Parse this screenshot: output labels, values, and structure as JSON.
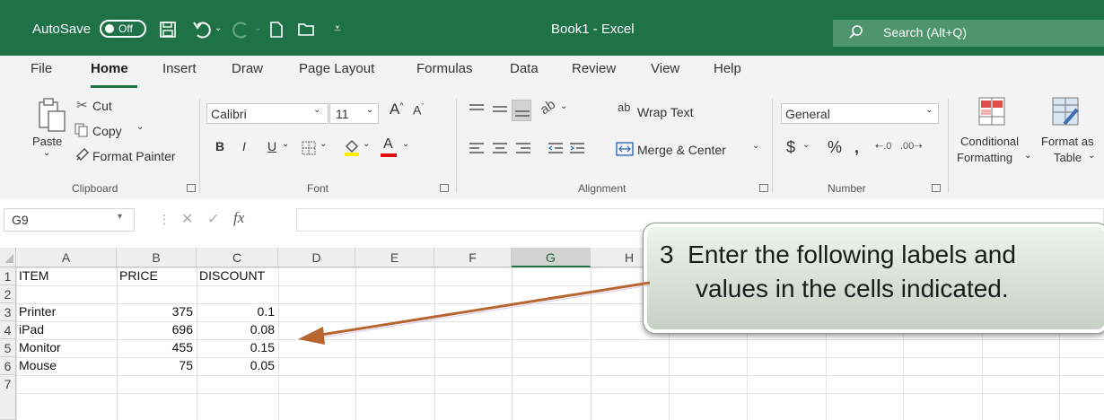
{
  "titlebar": {
    "autosave_label": "AutoSave",
    "autosave_state": "Off",
    "title": "Book1 - Excel",
    "search_placeholder": "Search (Alt+Q)"
  },
  "tabs": [
    "File",
    "Home",
    "Insert",
    "Draw",
    "Page Layout",
    "Formulas",
    "Data",
    "Review",
    "View",
    "Help"
  ],
  "active_tab": "Home",
  "ribbon": {
    "clipboard": {
      "paste": "Paste",
      "cut": "Cut",
      "copy": "Copy",
      "format_painter": "Format Painter",
      "group": "Clipboard"
    },
    "font": {
      "name": "Calibri",
      "size": "11",
      "bold": "B",
      "italic": "I",
      "underline": "U",
      "group": "Font"
    },
    "alignment": {
      "wrap_text": "Wrap Text",
      "merge_center": "Merge & Center",
      "group": "Alignment"
    },
    "number": {
      "format": "General",
      "currency": "$",
      "percent": "%",
      "comma": ")",
      "group": "Number"
    },
    "styles": {
      "conditional_l1": "Conditional",
      "conditional_l2": "Formatting",
      "format_as_l1": "Format as",
      "format_as_l2": "Table"
    }
  },
  "formula_bar": {
    "name_box": "G9",
    "fx": "fx"
  },
  "columns": [
    "A",
    "B",
    "C",
    "D",
    "E",
    "F",
    "G",
    "H"
  ],
  "rows": [
    [
      "ITEM",
      "PRICE",
      "DISCOUNT"
    ],
    [
      "",
      "",
      ""
    ],
    [
      "Printer",
      "375",
      "0.1"
    ],
    [
      "iPad",
      "696",
      "0.08"
    ],
    [
      "Monitor",
      "455",
      "0.15"
    ],
    [
      "Mouse",
      "75",
      "0.05"
    ],
    [
      "",
      "",
      ""
    ]
  ],
  "row_numbers": [
    "1",
    "2",
    "3",
    "4",
    "5",
    "6",
    "7"
  ],
  "callout": {
    "step": "3",
    "line1": "Enter the following labels and",
    "line2": "values in the cells indicated."
  },
  "colors": {
    "excel_green": "#1f7246",
    "arrow": "#b8662f",
    "selected_col": "#1f7246"
  }
}
